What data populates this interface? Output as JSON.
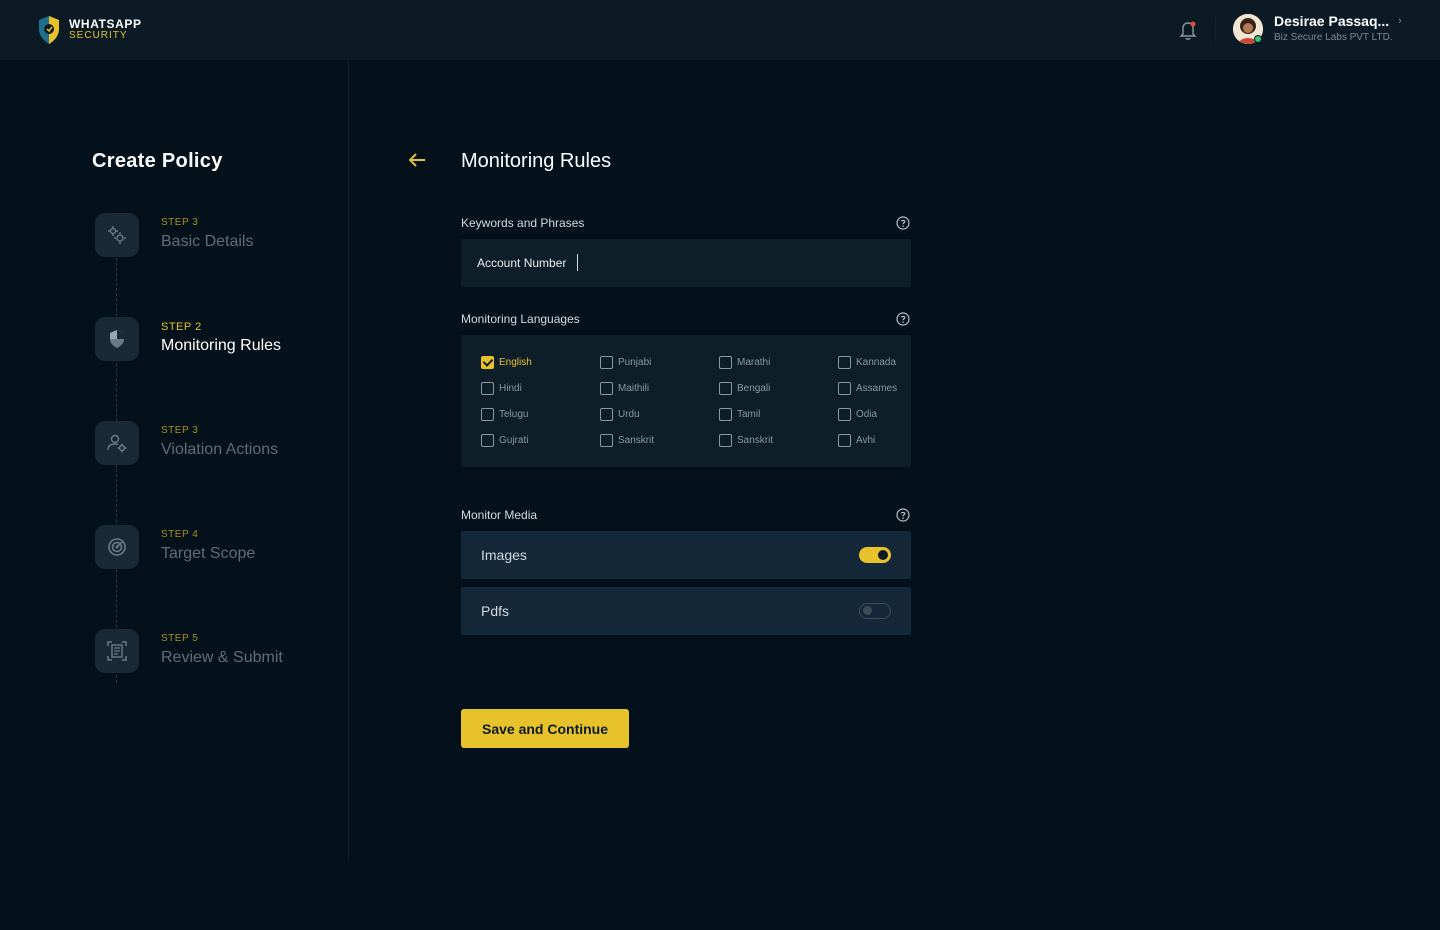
{
  "brand": {
    "name": "WHATSAPP",
    "sub": "SECURITY"
  },
  "user": {
    "name": "Desirae Passaq...",
    "org": "Biz Secure Labs PVT LTD."
  },
  "sidebar": {
    "title": "Create Policy",
    "steps": [
      {
        "num": "STEP 3",
        "label": "Basic Details",
        "icon": "gears-icon"
      },
      {
        "num": "STEP 2",
        "label": "Monitoring Rules",
        "icon": "shield-icon",
        "active": true
      },
      {
        "num": "STEP 3",
        "label": "Violation Actions",
        "icon": "user-gear-icon"
      },
      {
        "num": "STEP 4",
        "label": "Target Scope",
        "icon": "target-icon"
      },
      {
        "num": "STEP 5",
        "label": "Review & Submit",
        "icon": "document-scan-icon"
      }
    ]
  },
  "main": {
    "title": "Monitoring Rules",
    "keywords": {
      "label": "Keywords and Phrases",
      "value": "Account Number"
    },
    "languages": {
      "label": "Monitoring Languages",
      "items": [
        {
          "label": "English",
          "checked": true
        },
        {
          "label": "Punjabi",
          "checked": false
        },
        {
          "label": "Marathi",
          "checked": false
        },
        {
          "label": "Kannada",
          "checked": false
        },
        {
          "label": "Hindi",
          "checked": false
        },
        {
          "label": "Maithili",
          "checked": false
        },
        {
          "label": "Bengali",
          "checked": false
        },
        {
          "label": "Assames",
          "checked": false
        },
        {
          "label": "Telugu",
          "checked": false
        },
        {
          "label": "Urdu",
          "checked": false
        },
        {
          "label": "Tamil",
          "checked": false
        },
        {
          "label": "Odia",
          "checked": false
        },
        {
          "label": "Gujrati",
          "checked": false
        },
        {
          "label": "Sanskrit",
          "checked": false
        },
        {
          "label": "Sanskrit",
          "checked": false
        },
        {
          "label": "Avhi",
          "checked": false
        }
      ]
    },
    "media": {
      "label": "Monitor Media",
      "items": [
        {
          "label": "Images",
          "on": true
        },
        {
          "label": "Pdfs",
          "on": false
        }
      ]
    },
    "save_label": "Save and Continue"
  },
  "colors": {
    "accent": "#e7c22a",
    "background": "#04111a",
    "panel": "#0d1e29"
  }
}
